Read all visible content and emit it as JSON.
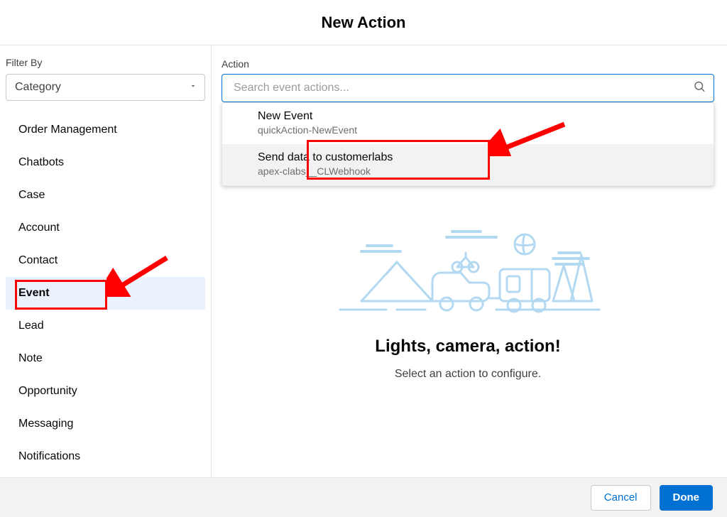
{
  "header": {
    "title": "New Action"
  },
  "sidebar": {
    "filter_label": "Filter By",
    "filter_value": "Category",
    "categories": [
      {
        "label": "Order Management"
      },
      {
        "label": "Chatbots"
      },
      {
        "label": "Case"
      },
      {
        "label": "Account"
      },
      {
        "label": "Contact"
      },
      {
        "label": "Event",
        "active": true
      },
      {
        "label": "Lead"
      },
      {
        "label": "Note"
      },
      {
        "label": "Opportunity"
      },
      {
        "label": "Messaging"
      },
      {
        "label": "Notifications"
      }
    ]
  },
  "main": {
    "action_label": "Action",
    "search_placeholder": "Search event actions...",
    "dropdown": [
      {
        "title": "New Event",
        "sub": "quickAction-NewEvent"
      },
      {
        "title": "Send data to customerlabs",
        "sub": "apex-clabs__CLWebhook",
        "hovered": true
      }
    ],
    "empty_heading": "Lights, camera, action!",
    "empty_sub": "Select an action to configure."
  },
  "footer": {
    "cancel": "Cancel",
    "done": "Done"
  },
  "colors": {
    "brand": "#0070d2",
    "annotation": "#ff0000"
  }
}
